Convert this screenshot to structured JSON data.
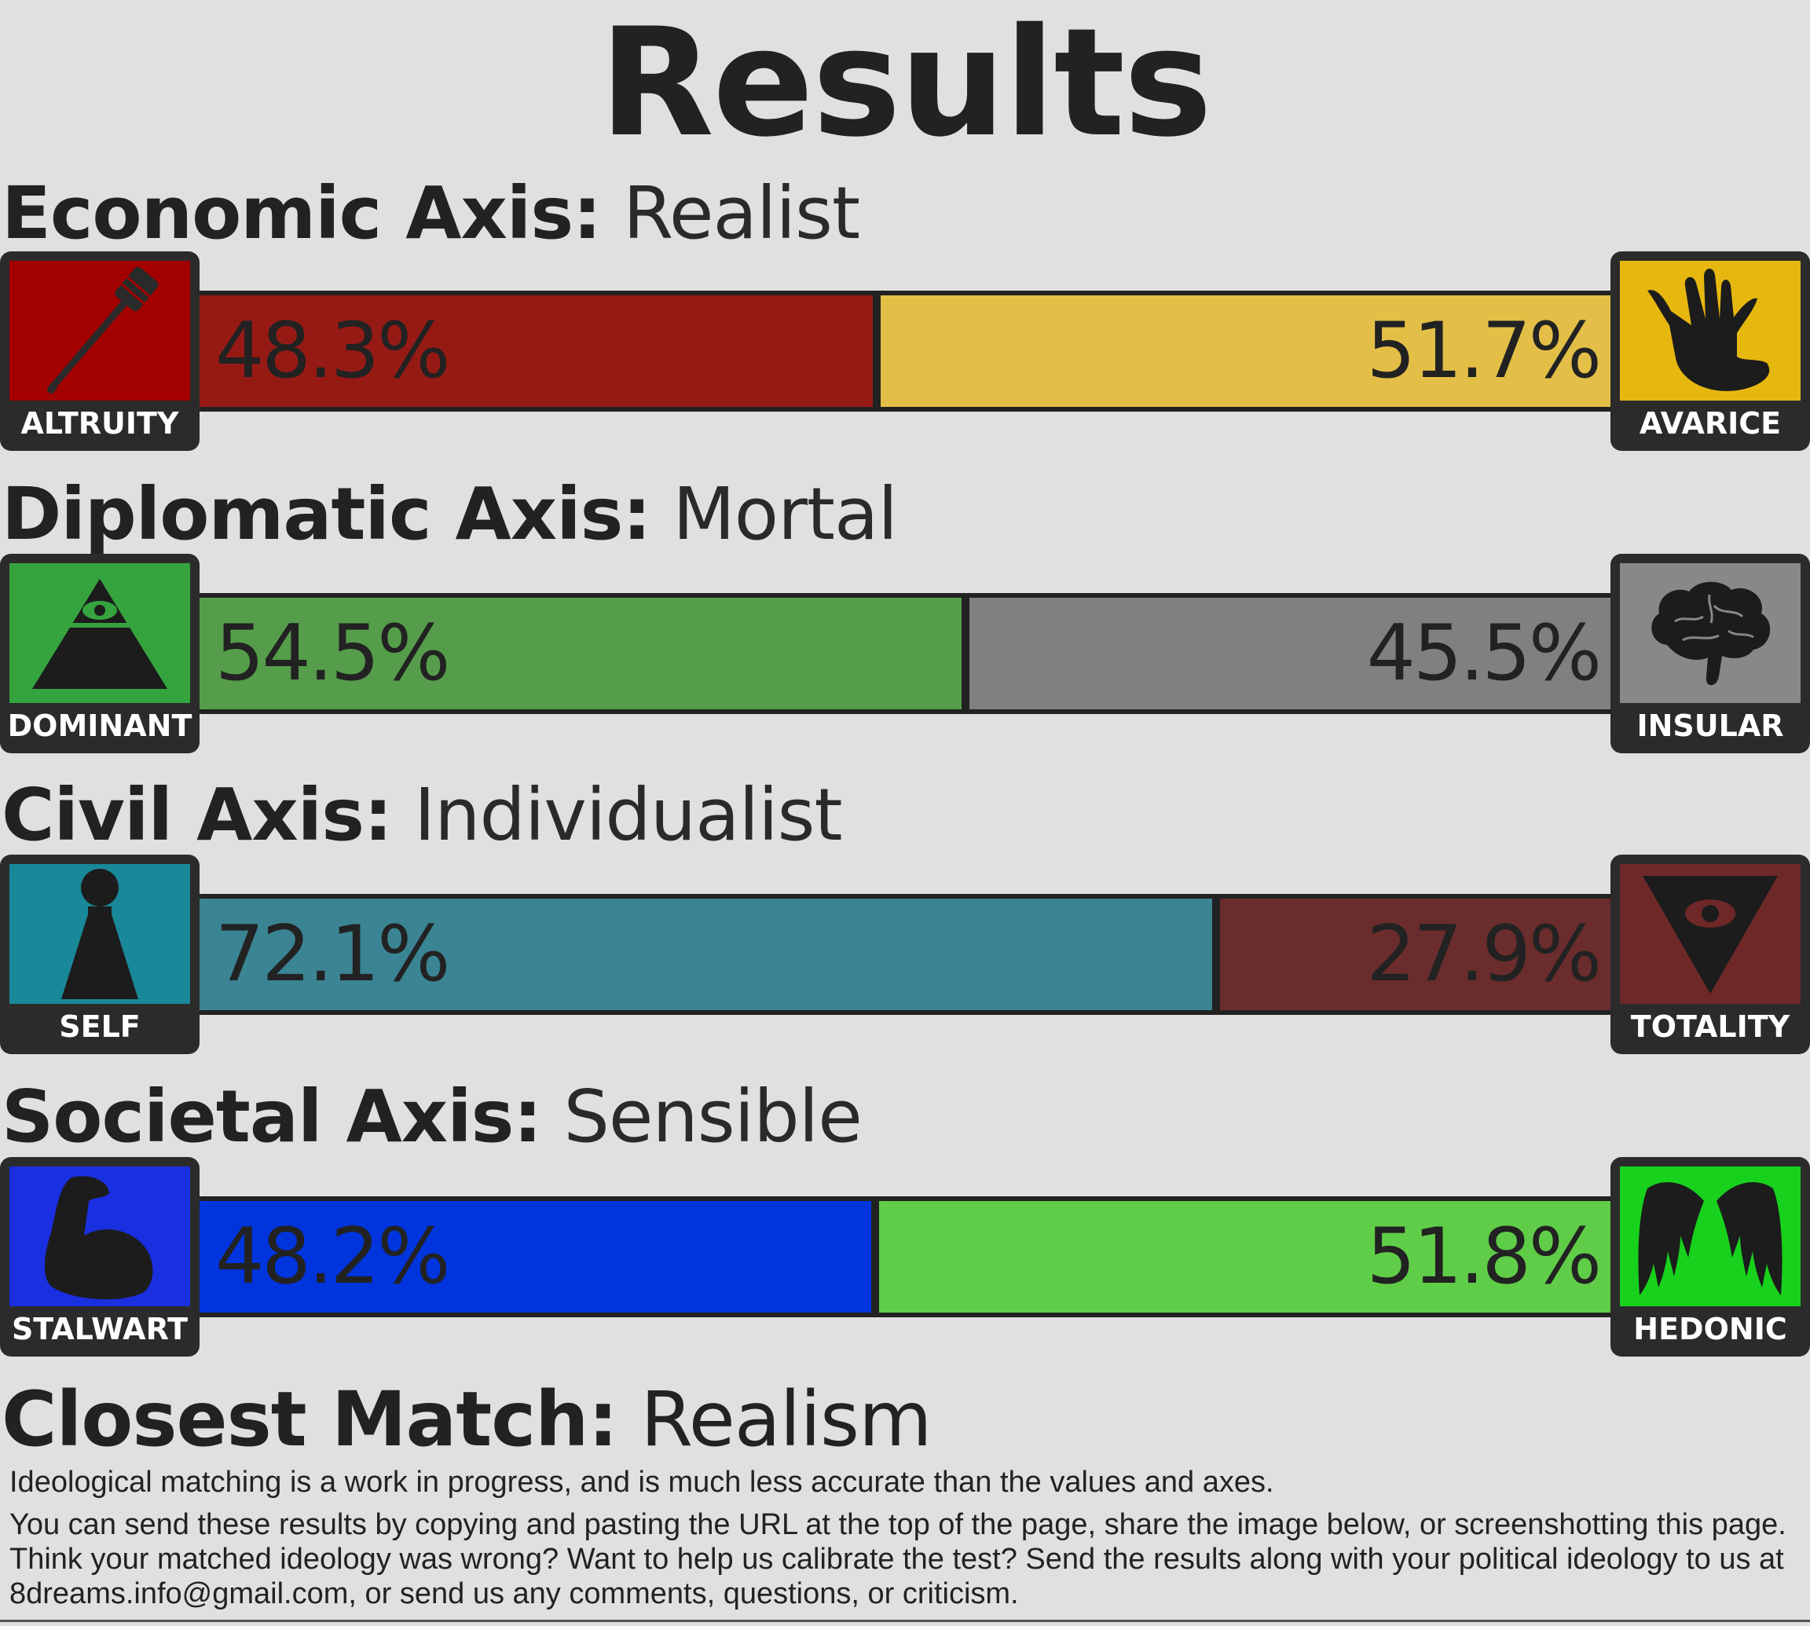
{
  "title": "Results",
  "axes": [
    {
      "label": "Economic Axis:",
      "value": "Realist",
      "left": {
        "name": "ALTRUITY",
        "icon": "toothbrush-icon",
        "percent_text": "48.3%",
        "fraction": 0.483,
        "bar_color": "#961a14",
        "icon_color": "#a30000"
      },
      "right": {
        "name": "AVARICE",
        "icon": "grabbing-hand-icon",
        "percent_text": "51.7%",
        "fraction": 0.517,
        "bar_color": "#e3bf47",
        "icon_color": "#e6b70f"
      }
    },
    {
      "label": "Diplomatic Axis:",
      "value": "Mortal",
      "left": {
        "name": "DOMINANT",
        "icon": "eye-pyramid-icon",
        "percent_text": "54.5%",
        "fraction": 0.545,
        "bar_color": "#559d4a",
        "icon_color": "#35a33e"
      },
      "right": {
        "name": "INSULAR",
        "icon": "brain-icon",
        "percent_text": "45.5%",
        "fraction": 0.455,
        "bar_color": "#808080",
        "icon_color": "#888888"
      }
    },
    {
      "label": "Civil Axis:",
      "value": "Individualist",
      "left": {
        "name": "SELF",
        "icon": "pawn-figure-icon",
        "percent_text": "72.1%",
        "fraction": 0.721,
        "bar_color": "#3a8494",
        "icon_color": "#198899"
      },
      "right": {
        "name": "TOTALITY",
        "icon": "eye-inverted-triangle-icon",
        "percent_text": "27.9%",
        "fraction": 0.279,
        "bar_color": "#6a2c2c",
        "icon_color": "#6e2828"
      }
    },
    {
      "label": "Societal Axis:",
      "value": "Sensible",
      "left": {
        "name": "STALWART",
        "icon": "flexed-arm-icon",
        "percent_text": "48.2%",
        "fraction": 0.482,
        "bar_color": "#0035de",
        "icon_color": "#1a2fe0"
      },
      "right": {
        "name": "HEDONIC",
        "icon": "wings-icon",
        "percent_text": "51.8%",
        "fraction": 0.518,
        "bar_color": "#60cd48",
        "icon_color": "#17d11c"
      }
    }
  ],
  "closest_match": {
    "label": "Closest Match:",
    "value": "Realism"
  },
  "notes": [
    "Ideological matching is a work in progress, and is much less accurate than the values and axes.",
    "You can send these results by copying and pasting the URL at the top of the page, share the image below, or screenshotting this page. Think your matched ideology was wrong? Want to help us calibrate the test? Send the results along with your political ideology to us at 8dreams.info@gmail.com, or send us any comments, questions, or criticism."
  ]
}
